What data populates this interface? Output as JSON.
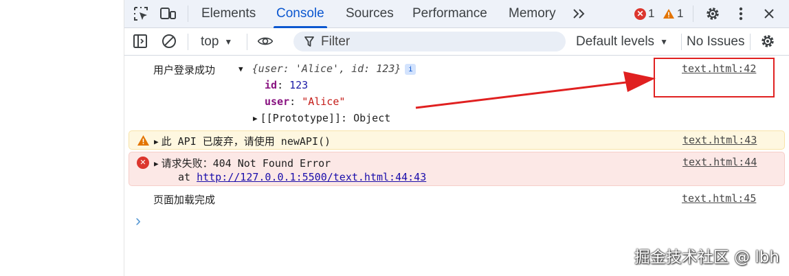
{
  "tabs": [
    "Elements",
    "Console",
    "Sources",
    "Performance",
    "Memory"
  ],
  "more_tabs_icon": "chevron-double-right",
  "counters": {
    "errors": "1",
    "warnings": "1"
  },
  "toolbar": {
    "context": "top",
    "filter_placeholder": "Filter",
    "levels": "Default levels",
    "issues": "No Issues"
  },
  "messages": {
    "m1": {
      "text": "用户登录成功",
      "preview": "{user: 'Alice', id: 123}",
      "info_badge": "i",
      "props": [
        {
          "key": "id",
          "sep": ": ",
          "value": "123"
        },
        {
          "key": "user",
          "sep": ": ",
          "value": "\"Alice\""
        }
      ],
      "prototype": "[[Prototype]]: Object",
      "source": "text.html:42"
    },
    "m2": {
      "text": "此 API 已废弃，请使用 newAPI()",
      "source": "text.html:43"
    },
    "m3": {
      "text": "请求失败：404 Not Found Error",
      "stack_prefix": "at ",
      "stack_link": "http://127.0.0.1:5500/text.html:44:43",
      "source": "text.html:44"
    },
    "m4": {
      "text": "页面加载完成",
      "source": "text.html:45"
    }
  },
  "prompt_symbol": "›",
  "watermark": "掘金技术社区 @ lbh",
  "colors": {
    "accent": "#0b57d0",
    "warning_bg": "#fef7e0",
    "error_bg": "#fce8e6",
    "annotation_red": "#e02020"
  }
}
